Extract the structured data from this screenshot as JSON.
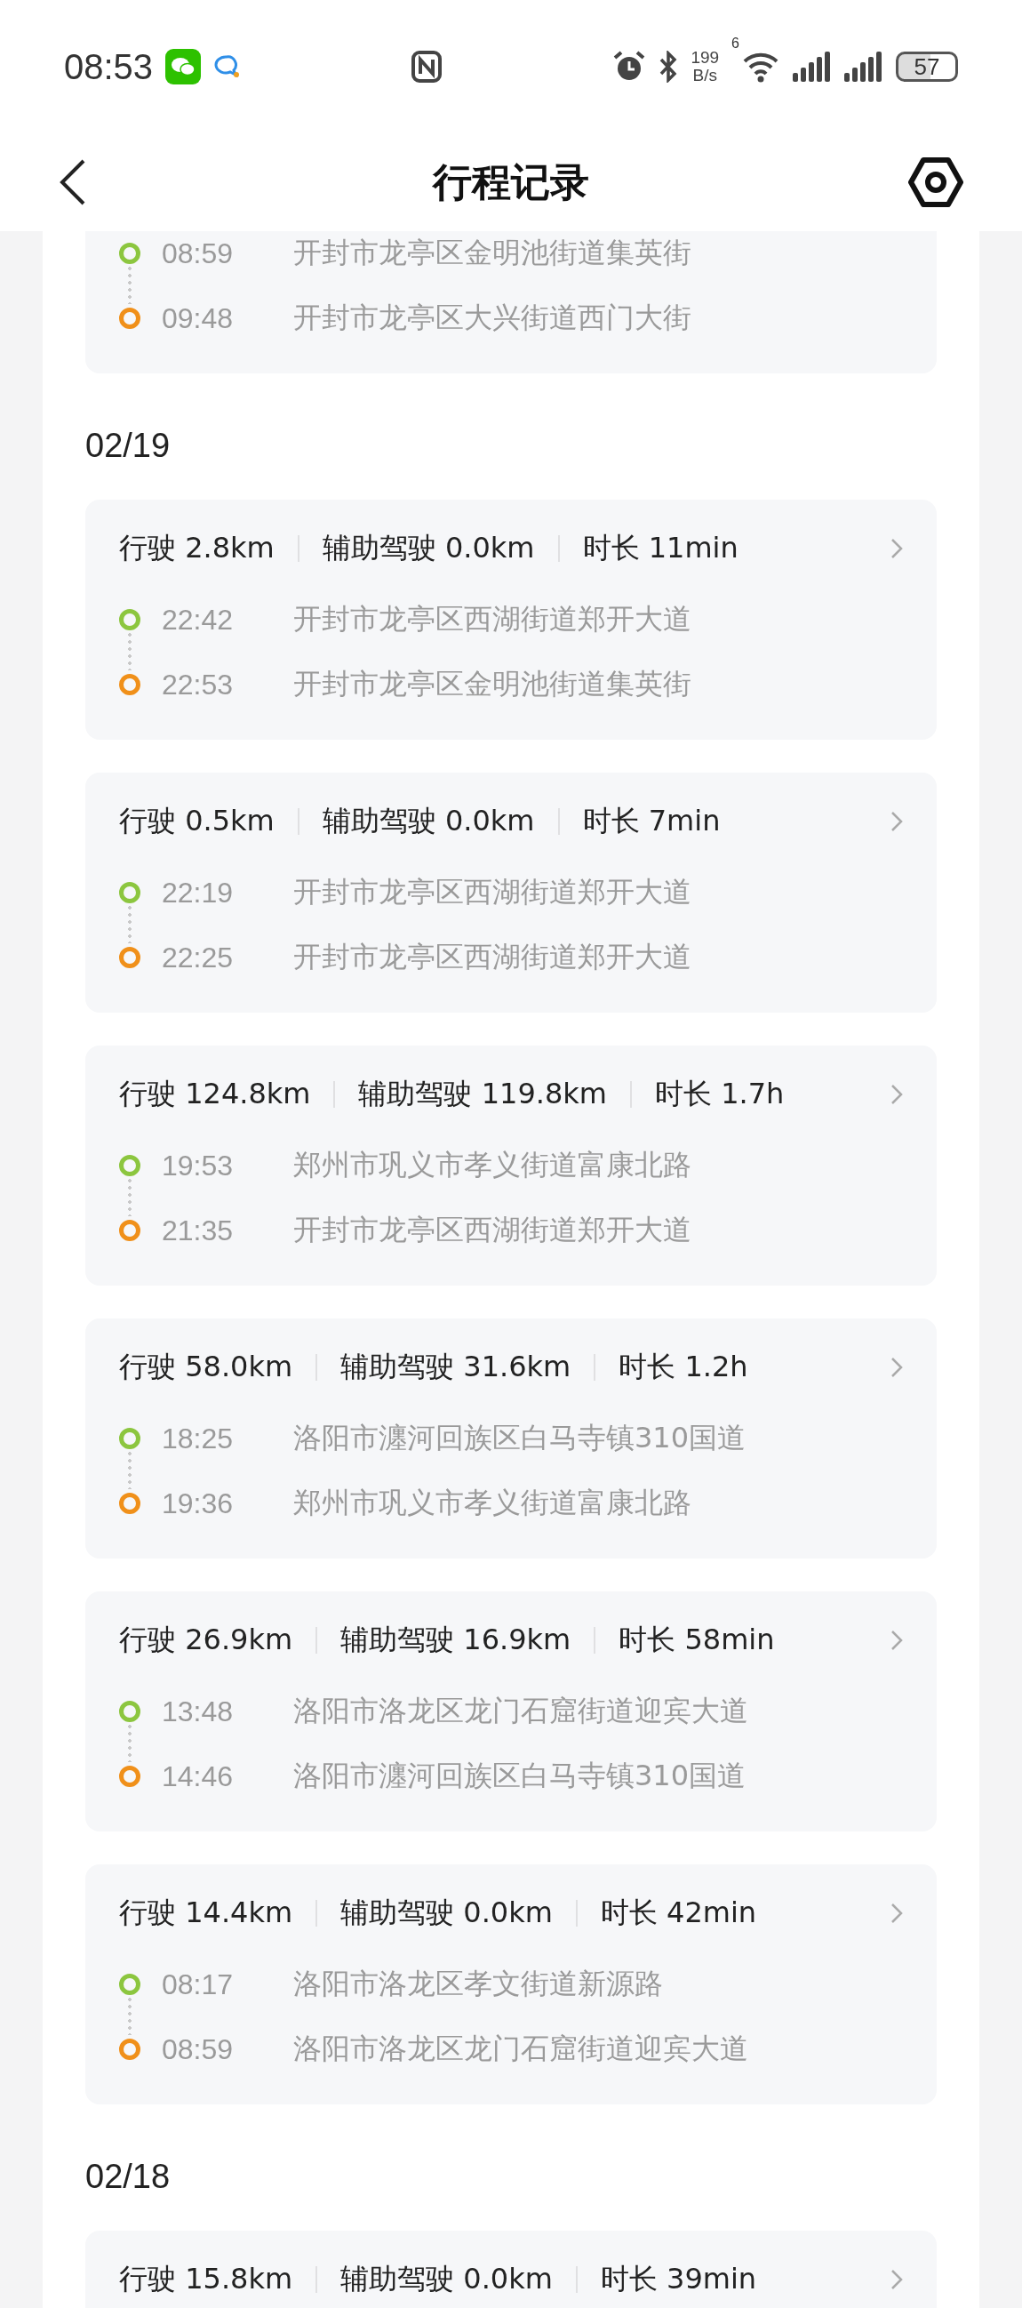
{
  "status_bar": {
    "time": "08:53",
    "speed_value": "199",
    "speed_unit": "B/s",
    "wifi_gen": "6",
    "battery": "57"
  },
  "header": {
    "title": "行程记录"
  },
  "top_partial_trip": {
    "routes": [
      {
        "kind": "start",
        "time": "08:59",
        "address": "开封市龙亭区金明池街道集英街"
      },
      {
        "kind": "end",
        "time": "09:48",
        "address": "开封市龙亭区大兴街道西门大街"
      }
    ]
  },
  "days": [
    {
      "date": "02/19",
      "trips": [
        {
          "summary": [
            "行驶 2.8km",
            "辅助驾驶 0.0km",
            "时长 11min"
          ],
          "routes": [
            {
              "kind": "start",
              "time": "22:42",
              "address": "开封市龙亭区西湖街道郑开大道"
            },
            {
              "kind": "end",
              "time": "22:53",
              "address": "开封市龙亭区金明池街道集英街"
            }
          ]
        },
        {
          "summary": [
            "行驶 0.5km",
            "辅助驾驶 0.0km",
            "时长 7min"
          ],
          "routes": [
            {
              "kind": "start",
              "time": "22:19",
              "address": "开封市龙亭区西湖街道郑开大道"
            },
            {
              "kind": "end",
              "time": "22:25",
              "address": "开封市龙亭区西湖街道郑开大道"
            }
          ]
        },
        {
          "summary": [
            "行驶 124.8km",
            "辅助驾驶 119.8km",
            "时长 1.7h"
          ],
          "routes": [
            {
              "kind": "start",
              "time": "19:53",
              "address": "郑州市巩义市孝义街道富康北路"
            },
            {
              "kind": "end",
              "time": "21:35",
              "address": "开封市龙亭区西湖街道郑开大道"
            }
          ]
        },
        {
          "summary": [
            "行驶 58.0km",
            "辅助驾驶 31.6km",
            "时长 1.2h"
          ],
          "routes": [
            {
              "kind": "start",
              "time": "18:25",
              "address": "洛阳市瀍河回族区白马寺镇310国道"
            },
            {
              "kind": "end",
              "time": "19:36",
              "address": "郑州市巩义市孝义街道富康北路"
            }
          ]
        },
        {
          "summary": [
            "行驶 26.9km",
            "辅助驾驶 16.9km",
            "时长 58min"
          ],
          "routes": [
            {
              "kind": "start",
              "time": "13:48",
              "address": "洛阳市洛龙区龙门石窟街道迎宾大道"
            },
            {
              "kind": "end",
              "time": "14:46",
              "address": "洛阳市瀍河回族区白马寺镇310国道"
            }
          ]
        },
        {
          "summary": [
            "行驶 14.4km",
            "辅助驾驶 0.0km",
            "时长 42min"
          ],
          "routes": [
            {
              "kind": "start",
              "time": "08:17",
              "address": "洛阳市洛龙区孝文街道新源路"
            },
            {
              "kind": "end",
              "time": "08:59",
              "address": "洛阳市洛龙区龙门石窟街道迎宾大道"
            }
          ]
        }
      ]
    },
    {
      "date": "02/18",
      "trips": [
        {
          "summary": [
            "行驶 15.8km",
            "辅助驾驶 0.0km",
            "时长 39min"
          ]
        }
      ]
    }
  ]
}
